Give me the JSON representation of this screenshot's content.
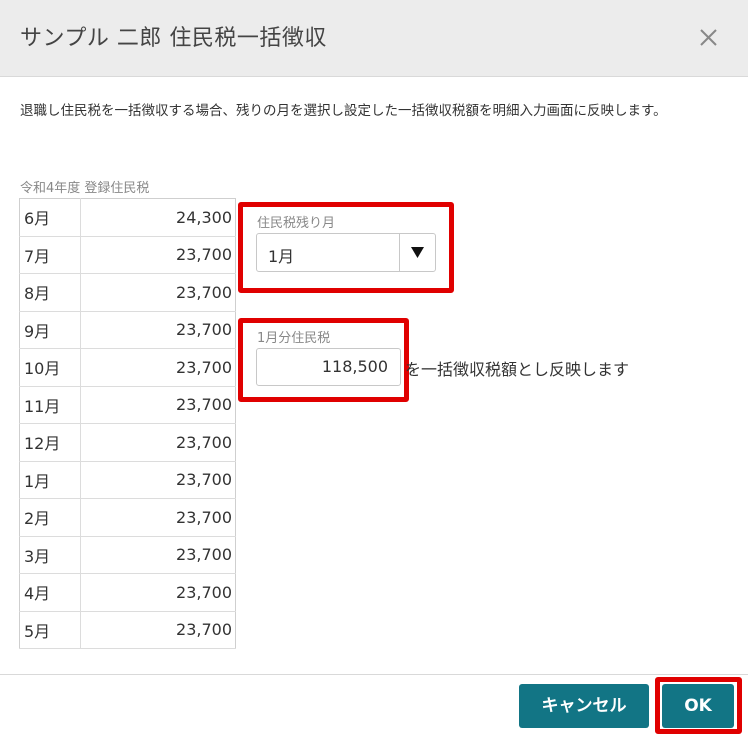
{
  "dialog": {
    "title": "サンプル 二郎 住民税一括徴収",
    "description": "退職し住民税を一括徴収する場合、残りの月を選択し設定した一括徴収税額を明細入力画面に反映します。"
  },
  "table": {
    "caption": "令和4年度 登録住民税",
    "rows": [
      {
        "month": "6月",
        "amount": "24,300"
      },
      {
        "month": "7月",
        "amount": "23,700"
      },
      {
        "month": "8月",
        "amount": "23,700"
      },
      {
        "month": "9月",
        "amount": "23,700"
      },
      {
        "month": "10月",
        "amount": "23,700"
      },
      {
        "month": "11月",
        "amount": "23,700"
      },
      {
        "month": "12月",
        "amount": "23,700"
      },
      {
        "month": "1月",
        "amount": "23,700"
      },
      {
        "month": "2月",
        "amount": "23,700"
      },
      {
        "month": "3月",
        "amount": "23,700"
      },
      {
        "month": "4月",
        "amount": "23,700"
      },
      {
        "month": "5月",
        "amount": "23,700"
      }
    ]
  },
  "remaining_month": {
    "label": "住民税残り月",
    "selected": "1月"
  },
  "lump_sum": {
    "label": "1月分住民税",
    "value": "118,500",
    "suffix": "を一括徴収税額とし反映します"
  },
  "footer": {
    "cancel_label": "キャンセル",
    "ok_label": "OK"
  },
  "colors": {
    "button": "#127585",
    "highlight": "#e00000",
    "header_bg": "#ececec"
  },
  "icons": {
    "close": "close-icon",
    "dropdown": "triangle-down-icon"
  }
}
